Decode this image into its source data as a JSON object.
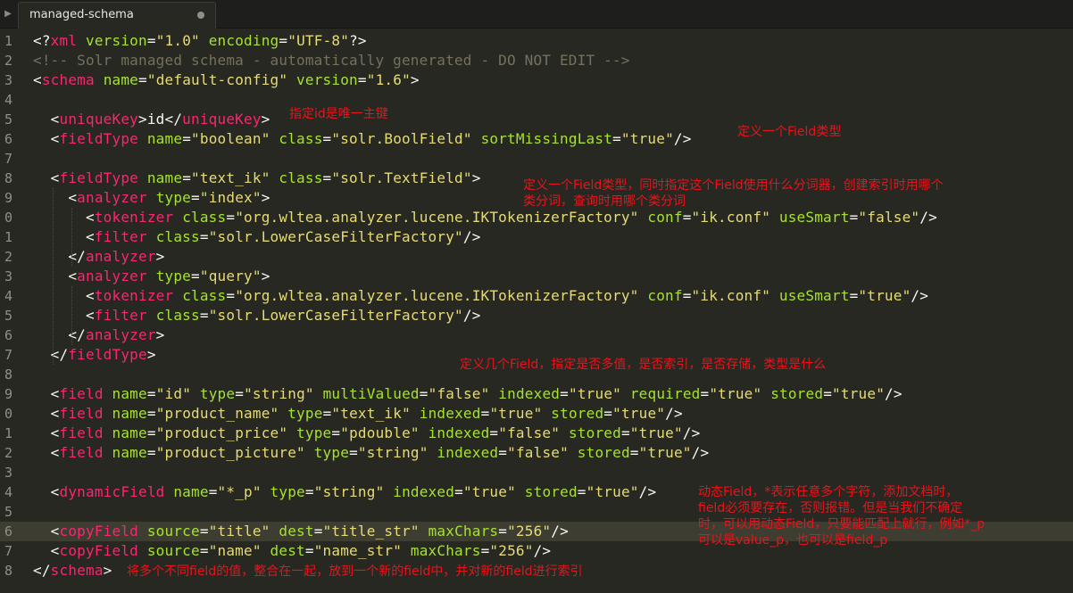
{
  "tab": {
    "title": "managed-schema",
    "arrow": "▶"
  },
  "gutter_numbers": [
    "1",
    "2",
    "3",
    "4",
    "5",
    "6",
    "7",
    "8",
    "9",
    "0",
    "1",
    "2",
    "3",
    "4",
    "5",
    "6",
    "7",
    "8",
    "9",
    "0",
    "1",
    "2",
    "3",
    "4",
    "5",
    "6",
    "7",
    "8"
  ],
  "active_line": 26,
  "code_lines": [
    [
      [
        "pun",
        "<?"
      ],
      [
        "tag",
        "xml"
      ],
      [
        "pun",
        " "
      ],
      [
        "attr",
        "version"
      ],
      [
        "pun",
        "="
      ],
      [
        "str",
        "\"1.0\""
      ],
      [
        "pun",
        " "
      ],
      [
        "attr",
        "encoding"
      ],
      [
        "pun",
        "="
      ],
      [
        "str",
        "\"UTF-8\""
      ],
      [
        "pun",
        "?>"
      ]
    ],
    [
      [
        "cmt",
        "<!-- Solr managed schema - automatically generated - DO NOT EDIT -->"
      ]
    ],
    [
      [
        "pun",
        "<"
      ],
      [
        "tag",
        "schema"
      ],
      [
        "pun",
        " "
      ],
      [
        "attr",
        "name"
      ],
      [
        "pun",
        "="
      ],
      [
        "str",
        "\"default-config\""
      ],
      [
        "pun",
        " "
      ],
      [
        "attr",
        "version"
      ],
      [
        "pun",
        "="
      ],
      [
        "str",
        "\"1.6\""
      ],
      [
        "pun",
        ">"
      ]
    ],
    [],
    [
      [
        "pun",
        "  <"
      ],
      [
        "tag",
        "uniqueKey"
      ],
      [
        "pun",
        ">id</"
      ],
      [
        "tag",
        "uniqueKey"
      ],
      [
        "pun",
        ">"
      ]
    ],
    [
      [
        "pun",
        "  <"
      ],
      [
        "tag",
        "fieldType"
      ],
      [
        "pun",
        " "
      ],
      [
        "attr",
        "name"
      ],
      [
        "pun",
        "="
      ],
      [
        "str",
        "\"boolean\""
      ],
      [
        "pun",
        " "
      ],
      [
        "attr",
        "class"
      ],
      [
        "pun",
        "="
      ],
      [
        "str",
        "\"solr.BoolField\""
      ],
      [
        "pun",
        " "
      ],
      [
        "attr",
        "sortMissingLast"
      ],
      [
        "pun",
        "="
      ],
      [
        "str",
        "\"true\""
      ],
      [
        "pun",
        "/>"
      ]
    ],
    [],
    [
      [
        "pun",
        "  <"
      ],
      [
        "tag",
        "fieldType"
      ],
      [
        "pun",
        " "
      ],
      [
        "attr",
        "name"
      ],
      [
        "pun",
        "="
      ],
      [
        "str",
        "\"text_ik\""
      ],
      [
        "pun",
        " "
      ],
      [
        "attr",
        "class"
      ],
      [
        "pun",
        "="
      ],
      [
        "str",
        "\"solr.TextField\""
      ],
      [
        "pun",
        ">"
      ]
    ],
    [
      [
        "pun",
        "    <"
      ],
      [
        "tag",
        "analyzer"
      ],
      [
        "pun",
        " "
      ],
      [
        "attr",
        "type"
      ],
      [
        "pun",
        "="
      ],
      [
        "str",
        "\"index\""
      ],
      [
        "pun",
        ">"
      ]
    ],
    [
      [
        "pun",
        "      <"
      ],
      [
        "tag",
        "tokenizer"
      ],
      [
        "pun",
        " "
      ],
      [
        "attr",
        "class"
      ],
      [
        "pun",
        "="
      ],
      [
        "str",
        "\"org.wltea.analyzer.lucene.IKTokenizerFactory\""
      ],
      [
        "pun",
        " "
      ],
      [
        "attr",
        "conf"
      ],
      [
        "pun",
        "="
      ],
      [
        "str",
        "\"ik.conf\""
      ],
      [
        "pun",
        " "
      ],
      [
        "attr",
        "useSmart"
      ],
      [
        "pun",
        "="
      ],
      [
        "str",
        "\"false\""
      ],
      [
        "pun",
        "/>"
      ]
    ],
    [
      [
        "pun",
        "      <"
      ],
      [
        "tag",
        "filter"
      ],
      [
        "pun",
        " "
      ],
      [
        "attr",
        "class"
      ],
      [
        "pun",
        "="
      ],
      [
        "str",
        "\"solr.LowerCaseFilterFactory\""
      ],
      [
        "pun",
        "/>"
      ]
    ],
    [
      [
        "pun",
        "    </"
      ],
      [
        "tag",
        "analyzer"
      ],
      [
        "pun",
        ">"
      ]
    ],
    [
      [
        "pun",
        "    <"
      ],
      [
        "tag",
        "analyzer"
      ],
      [
        "pun",
        " "
      ],
      [
        "attr",
        "type"
      ],
      [
        "pun",
        "="
      ],
      [
        "str",
        "\"query\""
      ],
      [
        "pun",
        ">"
      ]
    ],
    [
      [
        "pun",
        "      <"
      ],
      [
        "tag",
        "tokenizer"
      ],
      [
        "pun",
        " "
      ],
      [
        "attr",
        "class"
      ],
      [
        "pun",
        "="
      ],
      [
        "str",
        "\"org.wltea.analyzer.lucene.IKTokenizerFactory\""
      ],
      [
        "pun",
        " "
      ],
      [
        "attr",
        "conf"
      ],
      [
        "pun",
        "="
      ],
      [
        "str",
        "\"ik.conf\""
      ],
      [
        "pun",
        " "
      ],
      [
        "attr",
        "useSmart"
      ],
      [
        "pun",
        "="
      ],
      [
        "str",
        "\"true\""
      ],
      [
        "pun",
        "/>"
      ]
    ],
    [
      [
        "pun",
        "      <"
      ],
      [
        "tag",
        "filter"
      ],
      [
        "pun",
        " "
      ],
      [
        "attr",
        "class"
      ],
      [
        "pun",
        "="
      ],
      [
        "str",
        "\"solr.LowerCaseFilterFactory\""
      ],
      [
        "pun",
        "/>"
      ]
    ],
    [
      [
        "pun",
        "    </"
      ],
      [
        "tag",
        "analyzer"
      ],
      [
        "pun",
        ">"
      ]
    ],
    [
      [
        "pun",
        "  </"
      ],
      [
        "tag",
        "fieldType"
      ],
      [
        "pun",
        ">"
      ]
    ],
    [],
    [
      [
        "pun",
        "  <"
      ],
      [
        "tag",
        "field"
      ],
      [
        "pun",
        " "
      ],
      [
        "attr",
        "name"
      ],
      [
        "pun",
        "="
      ],
      [
        "str",
        "\"id\""
      ],
      [
        "pun",
        " "
      ],
      [
        "attr",
        "type"
      ],
      [
        "pun",
        "="
      ],
      [
        "str",
        "\"string\""
      ],
      [
        "pun",
        " "
      ],
      [
        "attr",
        "multiValued"
      ],
      [
        "pun",
        "="
      ],
      [
        "str",
        "\"false\""
      ],
      [
        "pun",
        " "
      ],
      [
        "attr",
        "indexed"
      ],
      [
        "pun",
        "="
      ],
      [
        "str",
        "\"true\""
      ],
      [
        "pun",
        " "
      ],
      [
        "attr",
        "required"
      ],
      [
        "pun",
        "="
      ],
      [
        "str",
        "\"true\""
      ],
      [
        "pun",
        " "
      ],
      [
        "attr",
        "stored"
      ],
      [
        "pun",
        "="
      ],
      [
        "str",
        "\"true\""
      ],
      [
        "pun",
        "/>"
      ]
    ],
    [
      [
        "pun",
        "  <"
      ],
      [
        "tag",
        "field"
      ],
      [
        "pun",
        " "
      ],
      [
        "attr",
        "name"
      ],
      [
        "pun",
        "="
      ],
      [
        "str",
        "\"product_name\""
      ],
      [
        "pun",
        " "
      ],
      [
        "attr",
        "type"
      ],
      [
        "pun",
        "="
      ],
      [
        "str",
        "\"text_ik\""
      ],
      [
        "pun",
        " "
      ],
      [
        "attr",
        "indexed"
      ],
      [
        "pun",
        "="
      ],
      [
        "str",
        "\"true\""
      ],
      [
        "pun",
        " "
      ],
      [
        "attr",
        "stored"
      ],
      [
        "pun",
        "="
      ],
      [
        "str",
        "\"true\""
      ],
      [
        "pun",
        "/>"
      ]
    ],
    [
      [
        "pun",
        "  <"
      ],
      [
        "tag",
        "field"
      ],
      [
        "pun",
        " "
      ],
      [
        "attr",
        "name"
      ],
      [
        "pun",
        "="
      ],
      [
        "str",
        "\"product_price\""
      ],
      [
        "pun",
        " "
      ],
      [
        "attr",
        "type"
      ],
      [
        "pun",
        "="
      ],
      [
        "str",
        "\"pdouble\""
      ],
      [
        "pun",
        " "
      ],
      [
        "attr",
        "indexed"
      ],
      [
        "pun",
        "="
      ],
      [
        "str",
        "\"false\""
      ],
      [
        "pun",
        " "
      ],
      [
        "attr",
        "stored"
      ],
      [
        "pun",
        "="
      ],
      [
        "str",
        "\"true\""
      ],
      [
        "pun",
        "/>"
      ]
    ],
    [
      [
        "pun",
        "  <"
      ],
      [
        "tag",
        "field"
      ],
      [
        "pun",
        " "
      ],
      [
        "attr",
        "name"
      ],
      [
        "pun",
        "="
      ],
      [
        "str",
        "\"product_picture\""
      ],
      [
        "pun",
        " "
      ],
      [
        "attr",
        "type"
      ],
      [
        "pun",
        "="
      ],
      [
        "str",
        "\"string\""
      ],
      [
        "pun",
        " "
      ],
      [
        "attr",
        "indexed"
      ],
      [
        "pun",
        "="
      ],
      [
        "str",
        "\"false\""
      ],
      [
        "pun",
        " "
      ],
      [
        "attr",
        "stored"
      ],
      [
        "pun",
        "="
      ],
      [
        "str",
        "\"true\""
      ],
      [
        "pun",
        "/>"
      ]
    ],
    [],
    [
      [
        "pun",
        "  <"
      ],
      [
        "tag",
        "dynamicField"
      ],
      [
        "pun",
        " "
      ],
      [
        "attr",
        "name"
      ],
      [
        "pun",
        "="
      ],
      [
        "str",
        "\"*_p\""
      ],
      [
        "pun",
        " "
      ],
      [
        "attr",
        "type"
      ],
      [
        "pun",
        "="
      ],
      [
        "str",
        "\"string\""
      ],
      [
        "pun",
        " "
      ],
      [
        "attr",
        "indexed"
      ],
      [
        "pun",
        "="
      ],
      [
        "str",
        "\"true\""
      ],
      [
        "pun",
        " "
      ],
      [
        "attr",
        "stored"
      ],
      [
        "pun",
        "="
      ],
      [
        "str",
        "\"true\""
      ],
      [
        "pun",
        "/>"
      ]
    ],
    [],
    [
      [
        "pun",
        "  <"
      ],
      [
        "tag",
        "copyField"
      ],
      [
        "pun",
        " "
      ],
      [
        "attr",
        "source"
      ],
      [
        "pun",
        "="
      ],
      [
        "str",
        "\"title\""
      ],
      [
        "pun",
        " "
      ],
      [
        "attr",
        "dest"
      ],
      [
        "pun",
        "="
      ],
      [
        "str",
        "\"title_str\""
      ],
      [
        "pun",
        " "
      ],
      [
        "attr",
        "maxChars"
      ],
      [
        "pun",
        "="
      ],
      [
        "str",
        "\"256\""
      ],
      [
        "pun",
        "/>"
      ]
    ],
    [
      [
        "pun",
        "  <"
      ],
      [
        "tag",
        "copyField"
      ],
      [
        "pun",
        " "
      ],
      [
        "attr",
        "source"
      ],
      [
        "pun",
        "="
      ],
      [
        "str",
        "\"name\""
      ],
      [
        "pun",
        " "
      ],
      [
        "attr",
        "dest"
      ],
      [
        "pun",
        "="
      ],
      [
        "str",
        "\"name_str\""
      ],
      [
        "pun",
        " "
      ],
      [
        "attr",
        "maxChars"
      ],
      [
        "pun",
        "="
      ],
      [
        "str",
        "\"256\""
      ],
      [
        "pun",
        "/>"
      ]
    ],
    [
      [
        "pun",
        "</"
      ],
      [
        "tag",
        "schema"
      ],
      [
        "pun",
        ">"
      ]
    ]
  ],
  "annotations": {
    "unique_key": "指定id是唯一主键",
    "field_type": "定义一个Field类型",
    "field_type_ik": "定义一个Field类型，同时指定这个Field使用什么分词器，创建索引时用哪个\n类分词，查询时用哪个类分词",
    "fields": "定义几个Field，指定是否多值，是否索引，是否存储，类型是什么",
    "dynamic_field": "动态Field，*表示任意多个字符，添加文档时，\nfield必须要存在，否则报错。但是当我们不确定\n时，可以用动态Field，只要能匹配上就行，例如*_p\n可以是value_p，也可以是field_p",
    "copy_field": "将多个不同field的值，整合在一起，放到一个新的field中，并对新的field进行索引"
  }
}
